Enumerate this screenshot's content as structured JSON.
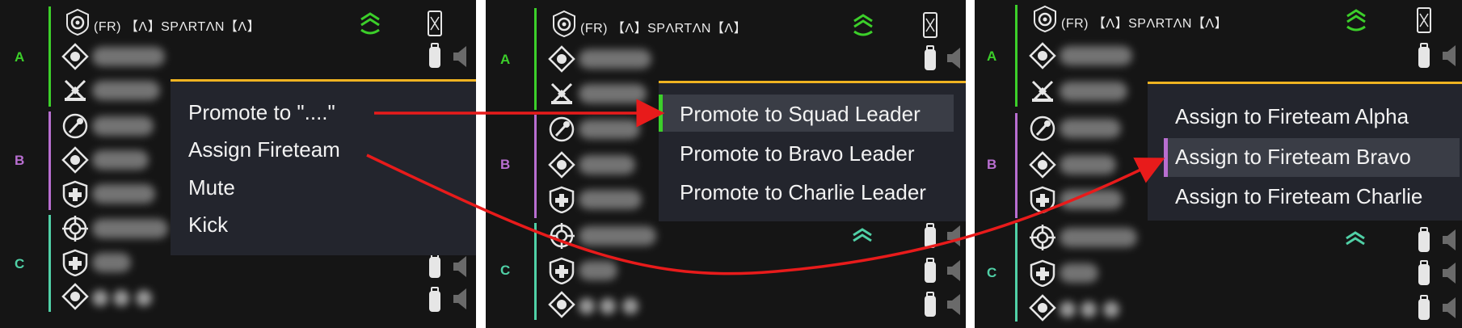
{
  "squad_leader_name": "(FR) 【Λ】SPΛRTΛN【Λ】",
  "groups": [
    {
      "label": "A",
      "color": "#3ccf2a"
    },
    {
      "label": "B",
      "color": "#b86ed0"
    },
    {
      "label": "C",
      "color": "#50d0a6"
    }
  ],
  "panel1": {
    "menu": [
      "Promote to \"....\"",
      "Assign Fireteam",
      "Mute",
      "Kick"
    ]
  },
  "panel2": {
    "menu": [
      "Promote to Squad Leader",
      "Promote to Bravo Leader",
      "Promote to Charlie Leader"
    ],
    "highlighted": "Promote to Squad Leader"
  },
  "panel3": {
    "menu": [
      "Assign to Fireteam Alpha",
      "Assign to Fireteam Bravo",
      "Assign to Fireteam Charlie"
    ],
    "highlighted": "Assign to Fireteam Bravo"
  },
  "colors": {
    "accent_yellow": "#efb321",
    "arrow_red": "#e81b1b",
    "rank_green": "#3ccf2a",
    "fireteam_up_green": "#50d0a6",
    "panel_bg": "#151515",
    "menu_bg": "#23252d"
  },
  "icons": [
    "rank-chevron-icon",
    "kit-card-icon",
    "speaker-icon",
    "role-badge-icon",
    "rank-sergeant-icon"
  ]
}
